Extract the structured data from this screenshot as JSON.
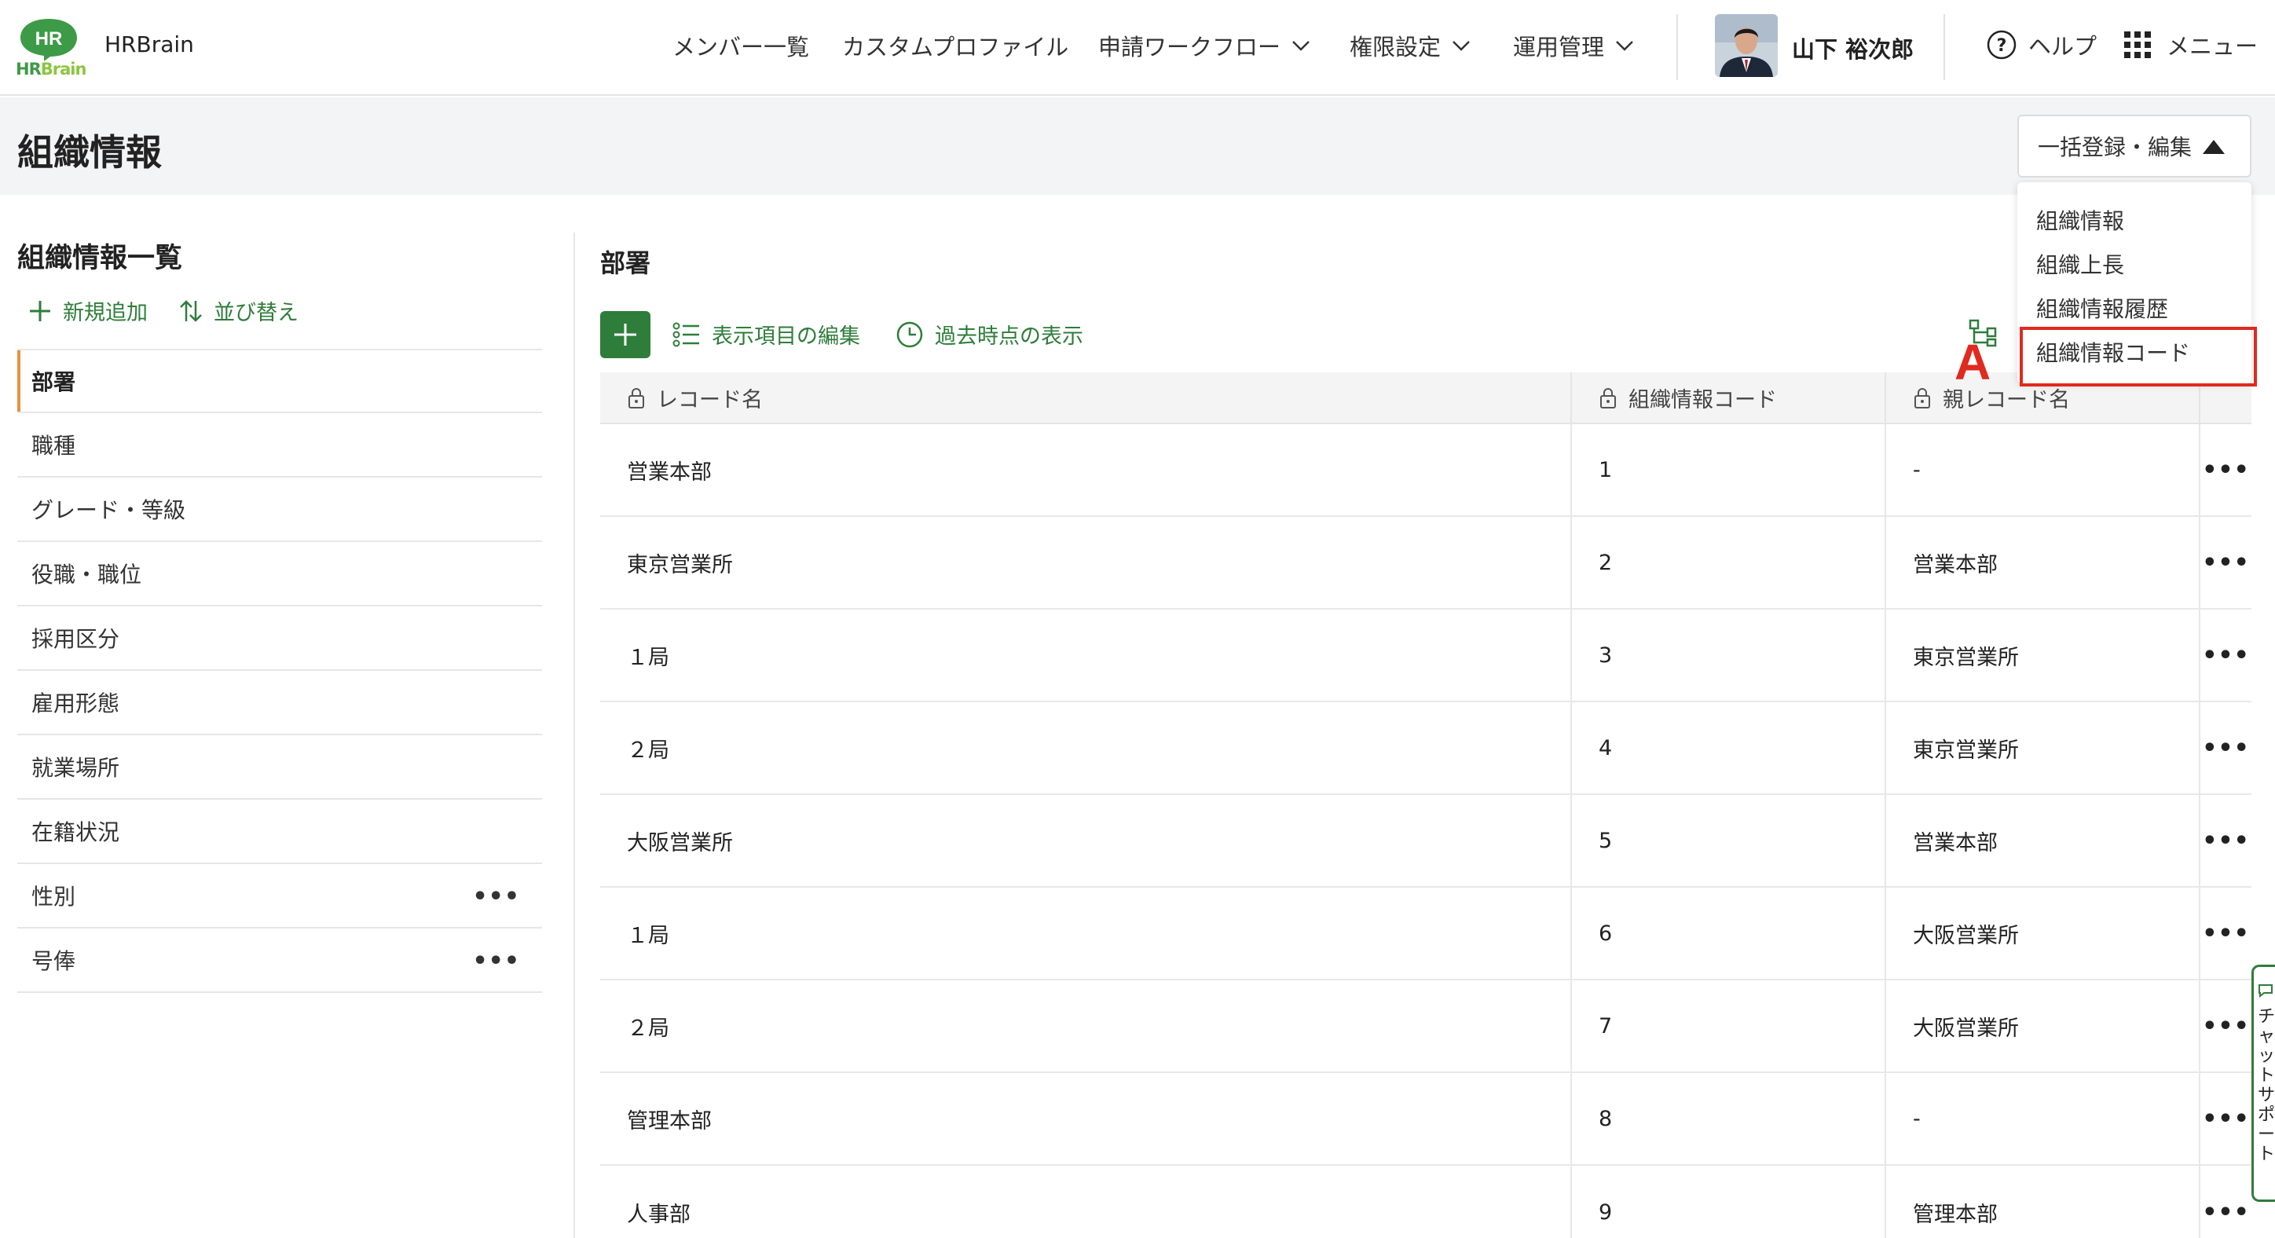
{
  "app": {
    "logo_text": "HR",
    "logo_sub_a": "HR",
    "logo_sub_b": "Brain",
    "name": "HRBrain"
  },
  "nav": {
    "members": "メンバー一覧",
    "custom_profile": "カスタムプロファイル",
    "workflow": "申請ワークフロー",
    "permissions": "権限設定",
    "operations": "運用管理"
  },
  "user": {
    "name": "山下 裕次郎"
  },
  "header_right": {
    "help": "ヘルプ",
    "menu": "メニュー"
  },
  "page": {
    "title": "組織情報",
    "bulk_button": "一括登録・編集"
  },
  "dropdown": {
    "items": [
      "組織情報",
      "組織上長",
      "組織情報履歴",
      "組織情報コード"
    ],
    "marker": "A"
  },
  "left": {
    "title": "組織情報一覧",
    "add_new": "新規追加",
    "sort": "並び替え",
    "items": [
      {
        "label": "部署"
      },
      {
        "label": "職種"
      },
      {
        "label": "グレード・等級"
      },
      {
        "label": "役職・職位"
      },
      {
        "label": "採用区分"
      },
      {
        "label": "雇用形態"
      },
      {
        "label": "就業場所"
      },
      {
        "label": "在籍状況"
      },
      {
        "label": "性別",
        "more": "•••"
      },
      {
        "label": "号俸",
        "more": "•••"
      }
    ]
  },
  "main": {
    "section_title": "部署",
    "edit_columns": "表示項目の編集",
    "past_view": "過去時点の表示",
    "columns": [
      "レコード名",
      "組織情報コード",
      "親レコード名"
    ],
    "rows": [
      {
        "name": "営業本部",
        "code": "1",
        "parent": "-"
      },
      {
        "name": "東京営業所",
        "code": "2",
        "parent": "営業本部"
      },
      {
        "name": "１局",
        "code": "3",
        "parent": "東京営業所"
      },
      {
        "name": "２局",
        "code": "4",
        "parent": "東京営業所"
      },
      {
        "name": "大阪営業所",
        "code": "5",
        "parent": "営業本部"
      },
      {
        "name": "１局",
        "code": "6",
        "parent": "大阪営業所"
      },
      {
        "name": "２局",
        "code": "7",
        "parent": "大阪営業所"
      },
      {
        "name": "管理本部",
        "code": "8",
        "parent": "-"
      },
      {
        "name": "人事部",
        "code": "9",
        "parent": "管理本部"
      }
    ],
    "row_more": "•••"
  },
  "chat": {
    "label": "チャットサポート"
  },
  "colors": {
    "brand_green": "#2e7d3a",
    "logo_green": "#3d9b47",
    "accent_orange": "#e8913c",
    "highlight_red": "#e02a1e"
  }
}
